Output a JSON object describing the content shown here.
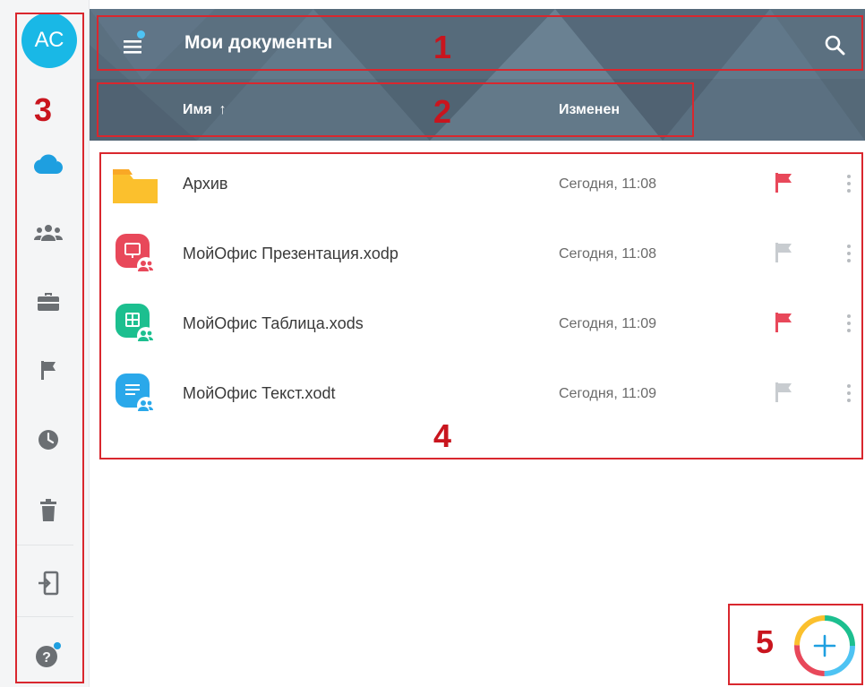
{
  "sidebar": {
    "avatar_initials": "АС",
    "items": [
      {
        "icon": "cloud-icon",
        "color": "#1e9fe0"
      },
      {
        "icon": "shared-users-icon",
        "color": "#6b6f73"
      },
      {
        "icon": "briefcase-icon",
        "color": "#6b6f73"
      },
      {
        "icon": "flag-icon",
        "color": "#6b6f73"
      },
      {
        "icon": "clock-icon",
        "color": "#6b6f73"
      },
      {
        "icon": "trash-icon",
        "color": "#6b6f73"
      },
      {
        "icon": "logout-icon",
        "color": "#6b6f73"
      },
      {
        "icon": "help-icon",
        "color": "#6b6f73"
      }
    ]
  },
  "header": {
    "title": "Мои документы",
    "background_color": "#5b7080"
  },
  "sortbar": {
    "name_label": "Имя",
    "name_sort_arrow": "↑",
    "changed_label": "Изменен"
  },
  "files": [
    {
      "name": "Архив",
      "date": "Сегодня, 11:08",
      "type": "folder",
      "flagged": true
    },
    {
      "name": "МойОфис Презентация.xodp",
      "date": "Сегодня, 11:08",
      "type": "presentation",
      "flagged": false,
      "shared": true
    },
    {
      "name": "МойОфис Таблица.xods",
      "date": "Сегодня, 11:09",
      "type": "spreadsheet",
      "flagged": true,
      "shared": true
    },
    {
      "name": "МойОфис Текст.xodt",
      "date": "Сегодня, 11:09",
      "type": "text",
      "flagged": false,
      "shared": true
    }
  ],
  "annotations": [
    "1",
    "2",
    "3",
    "4",
    "5"
  ],
  "colors": {
    "accent": "#1e9fe0",
    "flag_active": "#e8485a",
    "flag_inactive": "#c8ccd0",
    "folder": "#fbc02d",
    "presentation": "#e8485a",
    "spreadsheet": "#1cbf8f",
    "text": "#2aa8ea",
    "annotation": "#d9272e"
  }
}
